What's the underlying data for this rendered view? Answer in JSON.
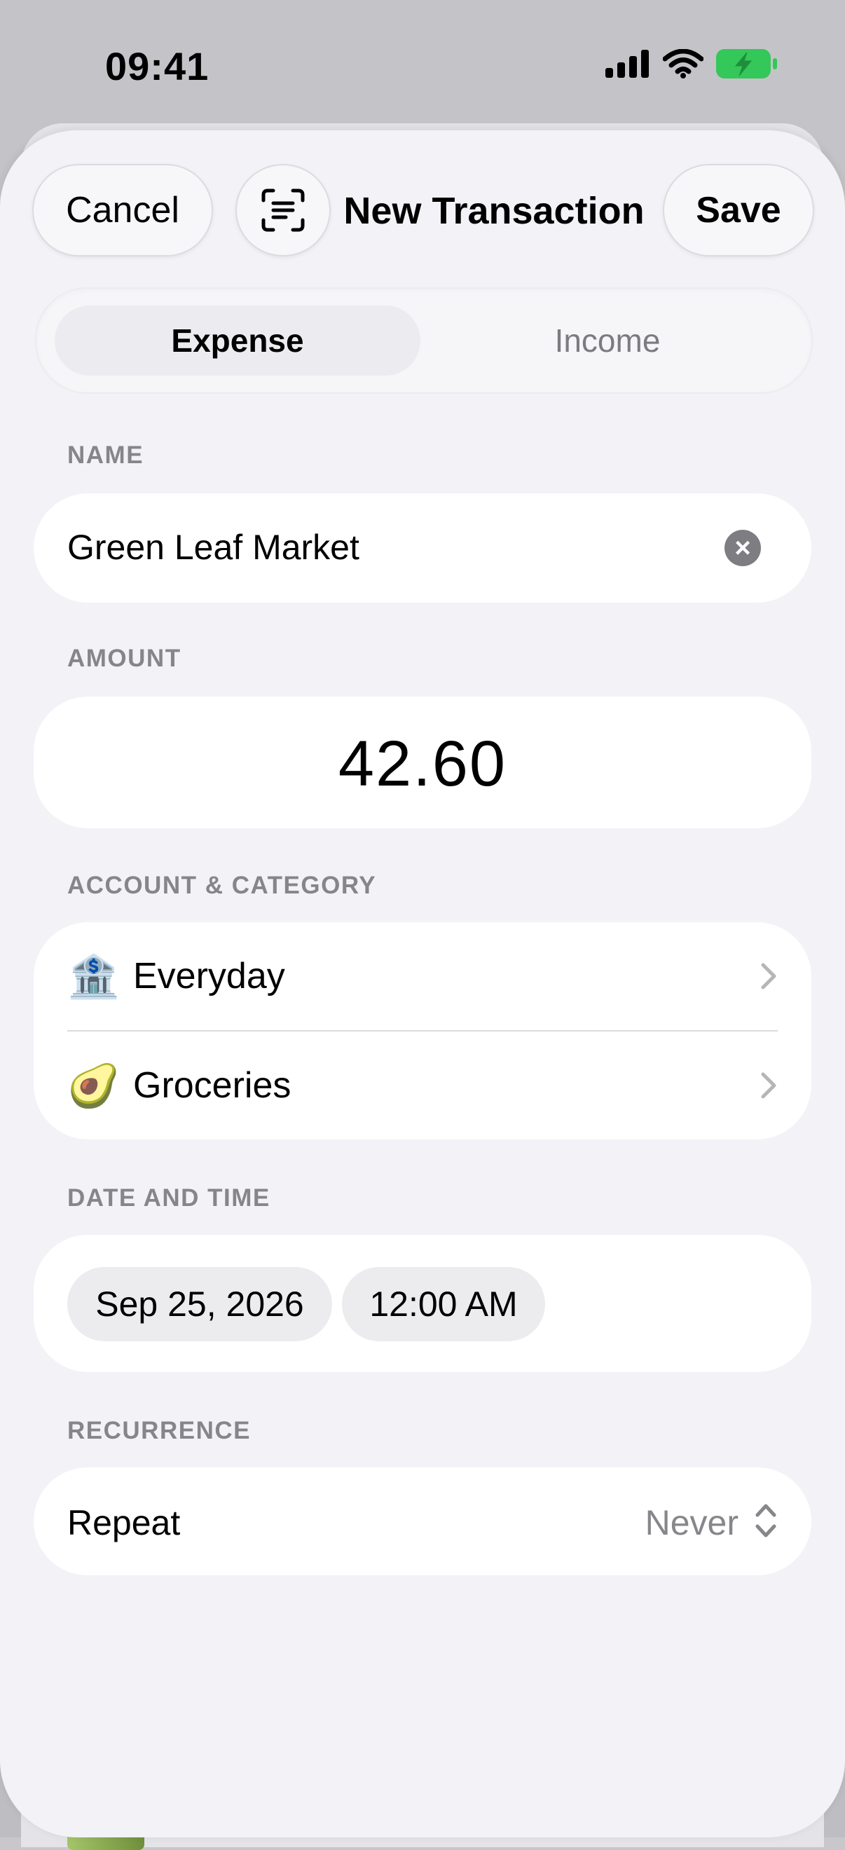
{
  "status_bar": {
    "time": "09:41"
  },
  "header": {
    "cancel_label": "Cancel",
    "title": "New Transaction",
    "save_label": "Save",
    "scan_icon": "document-scan-icon"
  },
  "type_segment": {
    "options": [
      "Expense",
      "Income"
    ],
    "selected": "Expense"
  },
  "name_section": {
    "label": "NAME",
    "value": "Green Leaf Market"
  },
  "amount_section": {
    "label": "AMOUNT",
    "value": "42.60"
  },
  "account_category_section": {
    "label": "ACCOUNT & CATEGORY",
    "rows": [
      {
        "emoji": "🏦",
        "label": "Everyday"
      },
      {
        "emoji": "🥑",
        "label": "Groceries"
      }
    ]
  },
  "datetime_section": {
    "label": "DATE AND TIME",
    "date": "Sep 25, 2026",
    "time": "12:00 AM"
  },
  "recurrence_section": {
    "label": "RECURRENCE",
    "row_label": "Repeat",
    "value": "Never"
  },
  "colors": {
    "battery": "#34c759",
    "accent_text": "#000000",
    "secondary_text": "#86868b"
  }
}
